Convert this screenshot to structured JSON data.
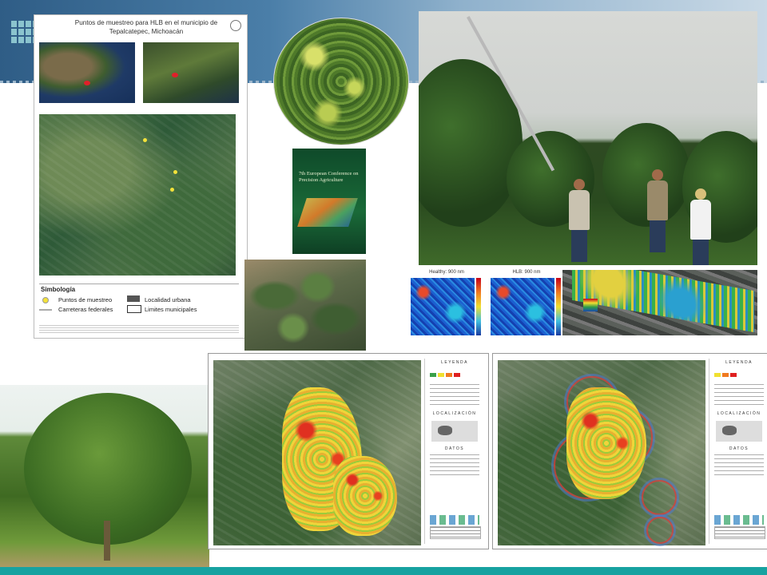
{
  "poster": {
    "title": "Puntos de muestreo para HLB en el municipio de Tepalcatepec, Michoacán",
    "legend": {
      "title": "Simbología",
      "items": [
        "Puntos de muestreo",
        "Carreteras federales",
        "Localidad urbana",
        "Limites municipales"
      ]
    }
  },
  "book": {
    "title": "7th European Conference on Precision Agriculture"
  },
  "heatmaps": {
    "left_label": "Healthy: 900 nm",
    "right_label": "HLB: 900 nm"
  },
  "maps": {
    "legend_title": "LEYENDA",
    "localizacion": "LOCALIZACIÓN",
    "datos": "DATOS"
  },
  "colors": {
    "accent_teal": "#17a2a0",
    "header_blue": "#2f5d86"
  }
}
